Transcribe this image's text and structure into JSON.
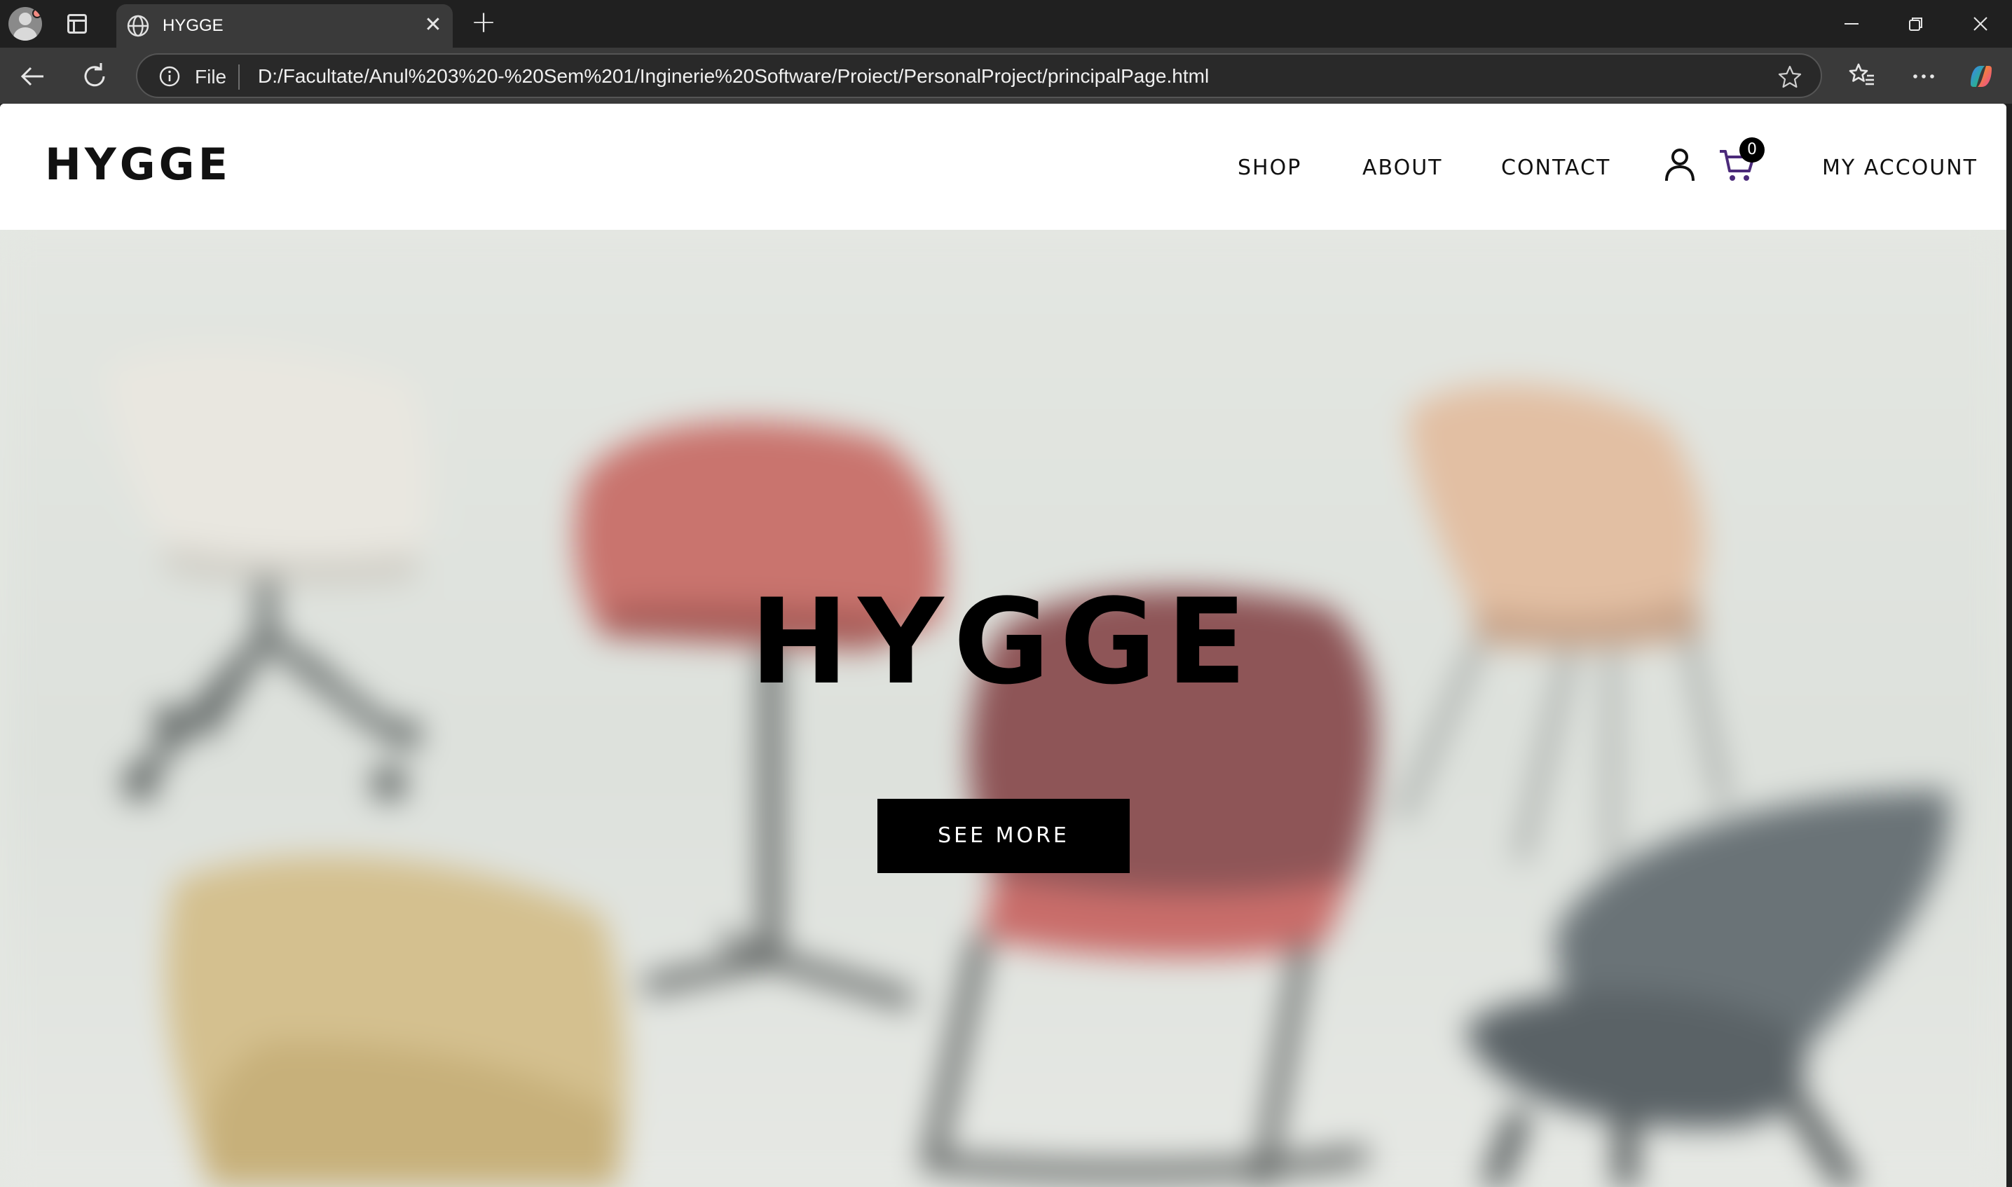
{
  "browser": {
    "tab_title": "HYGGE",
    "file_label": "File",
    "url": "D:/Facultate/Anul%203%20-%20Sem%201/Inginerie%20Software/Proiect/PersonalProject/principalPage.html",
    "tab_close_glyph": "✕",
    "new_tab_glyph": "+",
    "icons": [
      "profile-avatar-icon",
      "tab-actions-icon",
      "globe-icon",
      "back-icon",
      "refresh-icon",
      "info-icon",
      "favorite-star-icon",
      "favorites-icon",
      "more-icon",
      "copilot-icon",
      "minimize-icon",
      "restore-icon",
      "close-window-icon"
    ]
  },
  "site": {
    "logo": "HYGGE",
    "nav": {
      "shop": "SHOP",
      "about": "ABOUT",
      "contact": "CONTACT",
      "account": "MY ACCOUNT"
    },
    "cart_count": "0",
    "hero": {
      "title": "HYGGE",
      "button": "SEE MORE"
    }
  },
  "colors": {
    "chrome_dark": "#202020",
    "chrome_toolbar": "#3a3a3a",
    "page_bg": "#ffffff",
    "text": "#111111",
    "button_bg": "#000000",
    "hero_bg": "#e5e8e3"
  }
}
